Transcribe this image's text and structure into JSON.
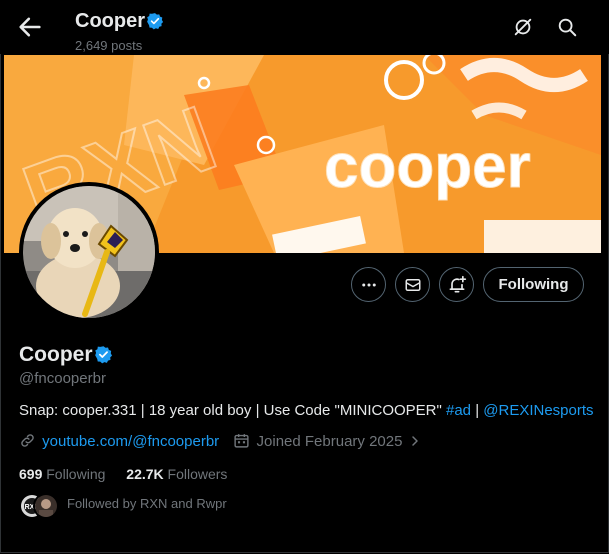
{
  "header": {
    "name": "Cooper",
    "posts": "2,649 posts"
  },
  "banner": {
    "wordmark": "cooper",
    "tag_text": "RXN"
  },
  "actions": {
    "follow_label": "Following"
  },
  "profile": {
    "name": "Cooper",
    "handle": "@fncooperbr",
    "bio_prefix": "Snap: cooper.331 | 18 year old boy | Use Code \"MINICOOPER\" ",
    "bio_hashtag": "#ad",
    "bio_sep": " | ",
    "bio_mention": "@REXINesports",
    "website": "youtube.com/@fncooperbr",
    "joined": "Joined February 2025",
    "following_count": "699",
    "following_label": "Following",
    "followers_count": "22.7K",
    "followers_label": "Followers",
    "followed_by": "Followed by RXN and Rwpr"
  },
  "colors": {
    "accent": "#1d9bf0",
    "banner_orange": "#f79a2c",
    "muted": "#71767b"
  }
}
